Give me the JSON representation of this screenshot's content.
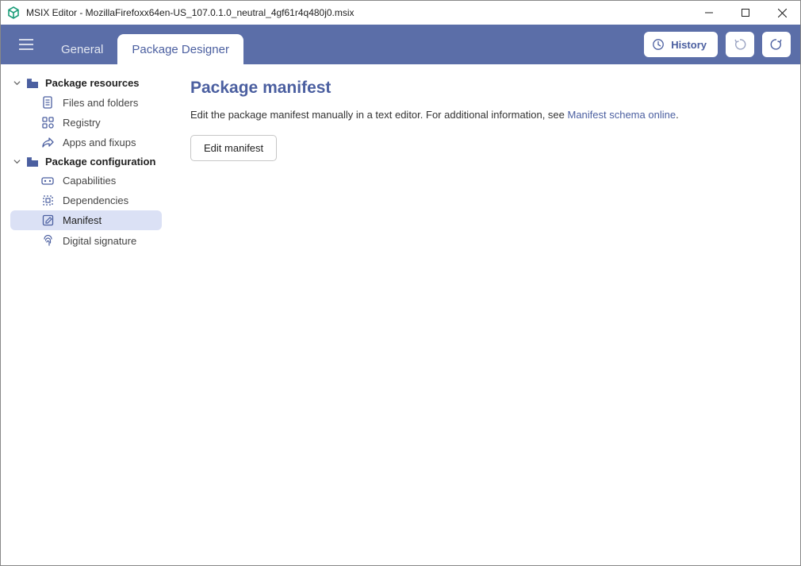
{
  "window": {
    "title": "MSIX Editor - MozillaFirefoxx64en-US_107.0.1.0_neutral_4gf61r4q480j0.msix"
  },
  "toolbar": {
    "tabs": {
      "general": "General",
      "designer": "Package Designer"
    },
    "history_label": "History"
  },
  "sidebar": {
    "groups": [
      {
        "label": "Package resources",
        "items": [
          {
            "label": "Files and folders"
          },
          {
            "label": "Registry"
          },
          {
            "label": "Apps and fixups"
          }
        ]
      },
      {
        "label": "Package configuration",
        "items": [
          {
            "label": "Capabilities"
          },
          {
            "label": "Dependencies"
          },
          {
            "label": "Manifest"
          },
          {
            "label": "Digital signature"
          }
        ]
      }
    ]
  },
  "main": {
    "title": "Package manifest",
    "description": "Edit the package manifest manually in a text editor. For additional information, see ",
    "link_text": "Manifest schema online",
    "desc_tail": ".",
    "edit_button": "Edit manifest"
  }
}
